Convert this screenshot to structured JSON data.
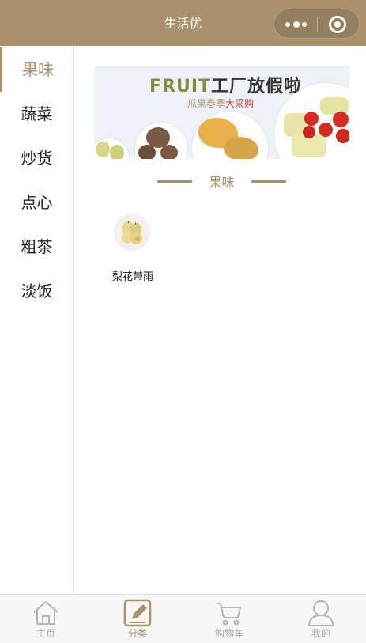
{
  "header": {
    "title": "生活优"
  },
  "sidebar": {
    "items": [
      {
        "label": "果味",
        "active": true
      },
      {
        "label": "蔬菜",
        "active": false
      },
      {
        "label": "炒货",
        "active": false
      },
      {
        "label": "点心",
        "active": false
      },
      {
        "label": "粗茶",
        "active": false
      },
      {
        "label": "淡饭",
        "active": false
      }
    ]
  },
  "banner": {
    "title_fruit": "FRUIT",
    "title_rest": "工厂放假啦",
    "subtitle_a": "瓜果春季",
    "subtitle_b": "大采购"
  },
  "section": {
    "title": "果味"
  },
  "products": [
    {
      "name": "梨花带雨",
      "icon": "pear-thumbnail"
    }
  ],
  "tabbar": {
    "tabs": [
      {
        "label": "主页",
        "icon": "home-icon",
        "active": false
      },
      {
        "label": "分类",
        "icon": "edit-category-icon",
        "active": true
      },
      {
        "label": "购物车",
        "icon": "cart-icon",
        "active": false
      },
      {
        "label": "我的",
        "icon": "user-icon",
        "active": false
      }
    ]
  },
  "colors": {
    "brand": "#a8916b",
    "inactive_tab": "#aaaaaa"
  }
}
